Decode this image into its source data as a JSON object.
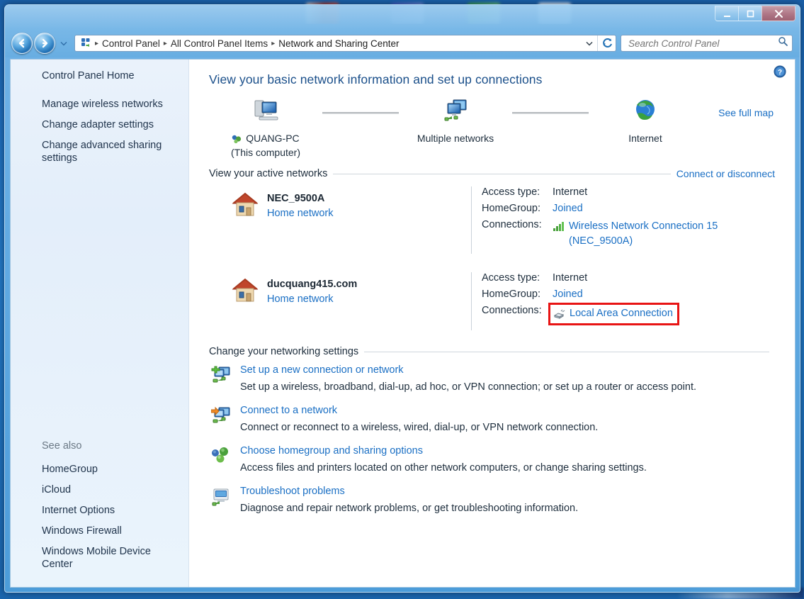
{
  "window": {
    "minimize_label": "Minimize",
    "maximize_label": "Maximize",
    "close_label": "Close"
  },
  "addressbar": {
    "back_label": "Back",
    "forward_label": "Forward",
    "recent_label": "Recent pages",
    "crumbs": [
      "Control Panel",
      "All Control Panel Items",
      "Network and Sharing Center"
    ],
    "separator": "▸",
    "refresh_label": "Refresh",
    "dropdown_label": "Previous locations"
  },
  "search": {
    "placeholder": "Search Control Panel",
    "value": ""
  },
  "sidebar": {
    "items": [
      {
        "label": "Control Panel Home"
      },
      {
        "label": "Manage wireless networks"
      },
      {
        "label": "Change adapter settings"
      },
      {
        "label": "Change advanced sharing settings"
      }
    ],
    "see_also_title": "See also",
    "see_also": [
      {
        "label": "HomeGroup"
      },
      {
        "label": "iCloud"
      },
      {
        "label": "Internet Options"
      },
      {
        "label": "Windows Firewall"
      },
      {
        "label": "Windows Mobile Device Center"
      }
    ]
  },
  "main": {
    "title": "View your basic network information and set up connections",
    "help_label": "Help",
    "netmap": {
      "see_full_map": "See full map",
      "nodes": [
        {
          "label": "QUANG-PC",
          "sublabel": "(This computer)",
          "icon": "computer-icon"
        },
        {
          "label": "Multiple networks",
          "sublabel": "",
          "icon": "multiple-networks-icon"
        },
        {
          "label": "Internet",
          "sublabel": "",
          "icon": "globe-icon"
        }
      ]
    },
    "active_networks": {
      "heading": "View your active networks",
      "action": "Connect or disconnect",
      "labels": {
        "access_type": "Access type:",
        "homegroup": "HomeGroup:",
        "connections": "Connections:"
      },
      "networks": [
        {
          "name": "NEC_9500A",
          "type": "Home network",
          "access_type": "Internet",
          "homegroup": "Joined",
          "connection_name": "Wireless Network Connection 15",
          "connection_name_line2": "(NEC_9500A)",
          "connection_icon": "wireless-signal-icon",
          "highlighted": false
        },
        {
          "name": "ducquang415.com",
          "type": "Home network",
          "access_type": "Internet",
          "homegroup": "Joined",
          "connection_name": "Local Area Connection",
          "connection_name_line2": "",
          "connection_icon": "ethernet-icon",
          "highlighted": true
        }
      ]
    },
    "settings": {
      "heading": "Change your networking settings",
      "items": [
        {
          "link": "Set up a new connection or network",
          "desc": "Set up a wireless, broadband, dial-up, ad hoc, or VPN connection; or set up a router or access point.",
          "icon": "new-connection-icon"
        },
        {
          "link": "Connect to a network",
          "desc": "Connect or reconnect to a wireless, wired, dial-up, or VPN network connection.",
          "icon": "connect-network-icon"
        },
        {
          "link": "Choose homegroup and sharing options",
          "desc": "Access files and printers located on other network computers, or change sharing settings.",
          "icon": "homegroup-icon"
        },
        {
          "link": "Troubleshoot problems",
          "desc": "Diagnose and repair network problems, or get troubleshooting information.",
          "icon": "troubleshoot-icon"
        }
      ]
    }
  },
  "colors": {
    "link": "#1a6fc4",
    "title": "#1a4f8a",
    "highlight": "#e81414",
    "sidebar_bg": "#e8f1fb"
  }
}
